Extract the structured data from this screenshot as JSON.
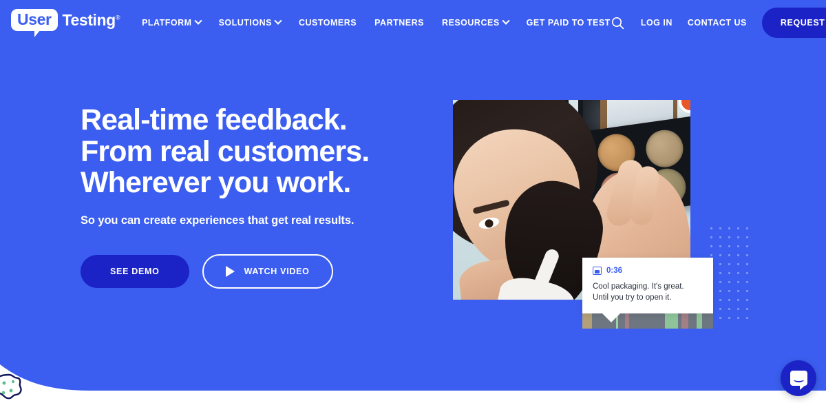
{
  "brand": {
    "logo_bubble_text": "User",
    "logo_word": "Testing",
    "logo_tm": "®",
    "background_color": "#3B5EF0",
    "accent_navy": "#1B23C7",
    "record_color": "#E8572A"
  },
  "nav": {
    "items": [
      {
        "label": "PLATFORM",
        "has_chevron": true
      },
      {
        "label": "SOLUTIONS",
        "has_chevron": true
      },
      {
        "label": "CUSTOMERS",
        "has_chevron": false
      },
      {
        "label": "PARTNERS",
        "has_chevron": false
      },
      {
        "label": "RESOURCES",
        "has_chevron": true
      },
      {
        "label": "GET PAID TO TEST",
        "has_chevron": false
      }
    ],
    "search_icon": "search-icon",
    "login_label": "LOG IN",
    "contact_label": "CONTACT US",
    "trial_label": "REQUEST TRIAL"
  },
  "hero": {
    "headline_line1": "Real-time feedback.",
    "headline_line2": "From real customers.",
    "headline_line3": "Wherever you work.",
    "subhead": "So you can create experiences that get real results.",
    "cta_primary": "SEE DEMO",
    "cta_secondary": "WATCH VIDEO",
    "play_icon": "play-icon"
  },
  "media": {
    "record_indicator": "record-dot-icon",
    "caption": {
      "image_icon": "image-icon",
      "timestamp": "0:36",
      "quote_line1": "Cool packaging. It's great.",
      "quote_line2": "Until you try to open it."
    },
    "filmstrip_segments": [
      {
        "color": "#b3a07a",
        "width": 9
      },
      {
        "color": "#6e7681",
        "width": 22
      },
      {
        "color": "#9fcfa6",
        "width": 2
      },
      {
        "color": "#6e7681",
        "width": 6
      },
      {
        "color": "#a37f86",
        "width": 4
      },
      {
        "color": "#6e7681",
        "width": 33
      },
      {
        "color": "#8fc49b",
        "width": 12
      },
      {
        "color": "#6e7681",
        "width": 3
      },
      {
        "color": "#a37f86",
        "width": 6
      },
      {
        "color": "#6e7681",
        "width": 8
      },
      {
        "color": "#8fc49b",
        "width": 5
      },
      {
        "color": "#6e7681",
        "width": 10
      }
    ]
  },
  "widgets": {
    "cookie_icon": "cookie-consent-icon",
    "chat_icon": "chat-launcher-icon"
  }
}
